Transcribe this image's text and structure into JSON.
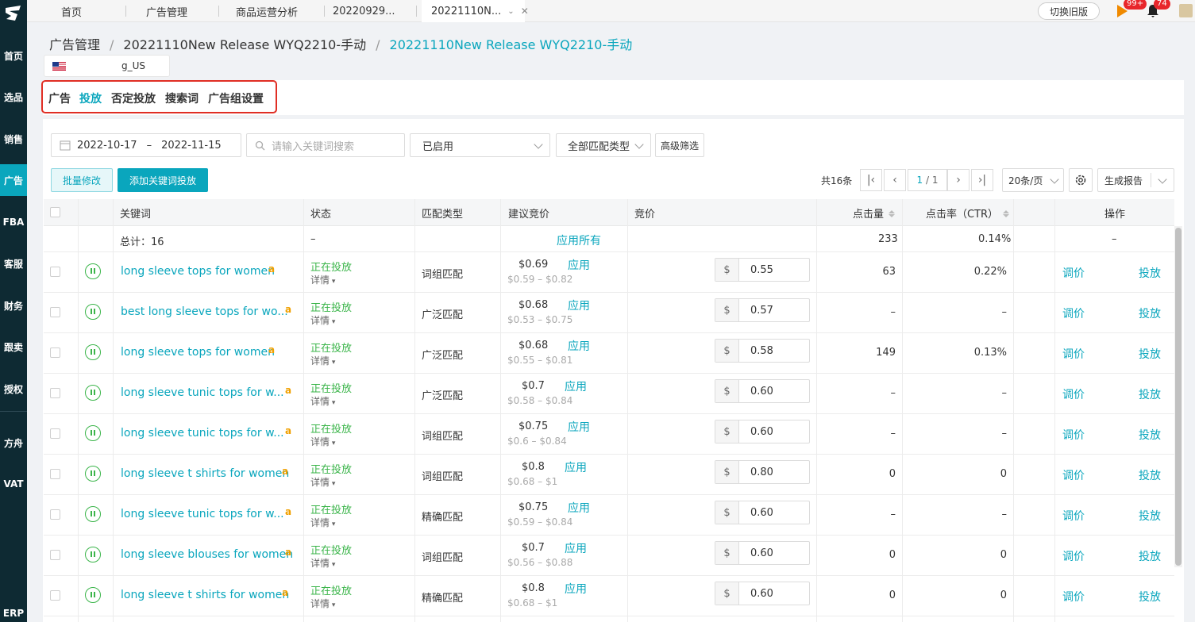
{
  "sidebar": {
    "items": [
      "首页",
      "选品",
      "销售",
      "广告",
      "FBA",
      "客服",
      "财务",
      "跟卖",
      "授权",
      "方舟",
      "VAT",
      "ERP"
    ],
    "active_index": 3
  },
  "topbar": {
    "tabs": [
      "首页",
      "广告管理",
      "商品运营分析",
      "20220929...",
      "20221110N..."
    ],
    "active_tab": 4,
    "switch_label": "切换旧版",
    "badge_orders": "99+",
    "badge_notifications": "74"
  },
  "breadcrumb": {
    "root": "广告管理",
    "campaign": "20221110New Release WYQ2210-手动",
    "group": "20221110New Release WYQ2210-手动"
  },
  "store": {
    "name": "g_US"
  },
  "subnav": {
    "items": [
      "广告",
      "投放",
      "否定投放",
      "搜索词",
      "广告组设置"
    ],
    "active_index": 1
  },
  "filters": {
    "date_start": "2022-10-17",
    "date_sep": "–",
    "date_end": "2022-11-15",
    "search_placeholder": "请输入关键词搜索",
    "status_value": "已启用",
    "match_value": "全部匹配类型",
    "advanced_label": "高级筛选"
  },
  "actions": {
    "batch_label": "批量修改",
    "add_label": "添加关键词投放",
    "total": "共16条",
    "page_current": "1",
    "page_total": "/ 1",
    "page_size": "20条/页",
    "report_label": "生成报告"
  },
  "table": {
    "headers": {
      "keyword": "关键词",
      "status": "状态",
      "match": "匹配类型",
      "suggest": "建议竞价",
      "bid": "竞价",
      "clicks": "点击量",
      "ctr": "点击率（CTR）",
      "op": "操作"
    },
    "summary": {
      "label": "总计：16",
      "status": "–",
      "apply_all": "应用所有",
      "clicks": "233",
      "ctr": "0.14%",
      "op": "–"
    },
    "apply_label": "应用",
    "status_text": "正在投放",
    "detail_text": "详情",
    "currency": "$",
    "adjust_label": "调价",
    "target_label": "投放",
    "rows": [
      {
        "keyword": "long sleeve tops for women",
        "match": "词组匹配",
        "suggest": "$0.69",
        "range": "$0.59 – $0.82",
        "bid": "0.55",
        "clicks": "63",
        "ctr": "0.22%"
      },
      {
        "keyword": "best long sleeve tops for wo...",
        "match": "广泛匹配",
        "suggest": "$0.68",
        "range": "$0.53 – $0.75",
        "bid": "0.57",
        "clicks": "–",
        "ctr": "–"
      },
      {
        "keyword": "long sleeve tops for women",
        "match": "广泛匹配",
        "suggest": "$0.68",
        "range": "$0.55 – $0.81",
        "bid": "0.58",
        "clicks": "149",
        "ctr": "0.13%"
      },
      {
        "keyword": "long sleeve tunic tops for w...",
        "match": "广泛匹配",
        "suggest": "$0.7",
        "range": "$0.58 – $0.84",
        "bid": "0.60",
        "clicks": "–",
        "ctr": "–"
      },
      {
        "keyword": "long sleeve tunic tops for w...",
        "match": "词组匹配",
        "suggest": "$0.75",
        "range": "$0.6 – $0.84",
        "bid": "0.60",
        "clicks": "–",
        "ctr": "–"
      },
      {
        "keyword": "long sleeve t shirts for women",
        "match": "词组匹配",
        "suggest": "$0.8",
        "range": "$0.68 – $1",
        "bid": "0.80",
        "clicks": "0",
        "ctr": "0"
      },
      {
        "keyword": "long sleeve tunic tops for w...",
        "match": "精确匹配",
        "suggest": "$0.75",
        "range": "$0.59 – $0.84",
        "bid": "0.60",
        "clicks": "–",
        "ctr": "–"
      },
      {
        "keyword": "long sleeve blouses for women",
        "match": "词组匹配",
        "suggest": "$0.7",
        "range": "$0.56 – $0.88",
        "bid": "0.60",
        "clicks": "0",
        "ctr": "0"
      },
      {
        "keyword": "long sleeve t shirts for women",
        "match": "精确匹配",
        "suggest": "$0.8",
        "range": "$0.68 – $1",
        "bid": "0.60",
        "clicks": "0",
        "ctr": "0"
      }
    ]
  }
}
